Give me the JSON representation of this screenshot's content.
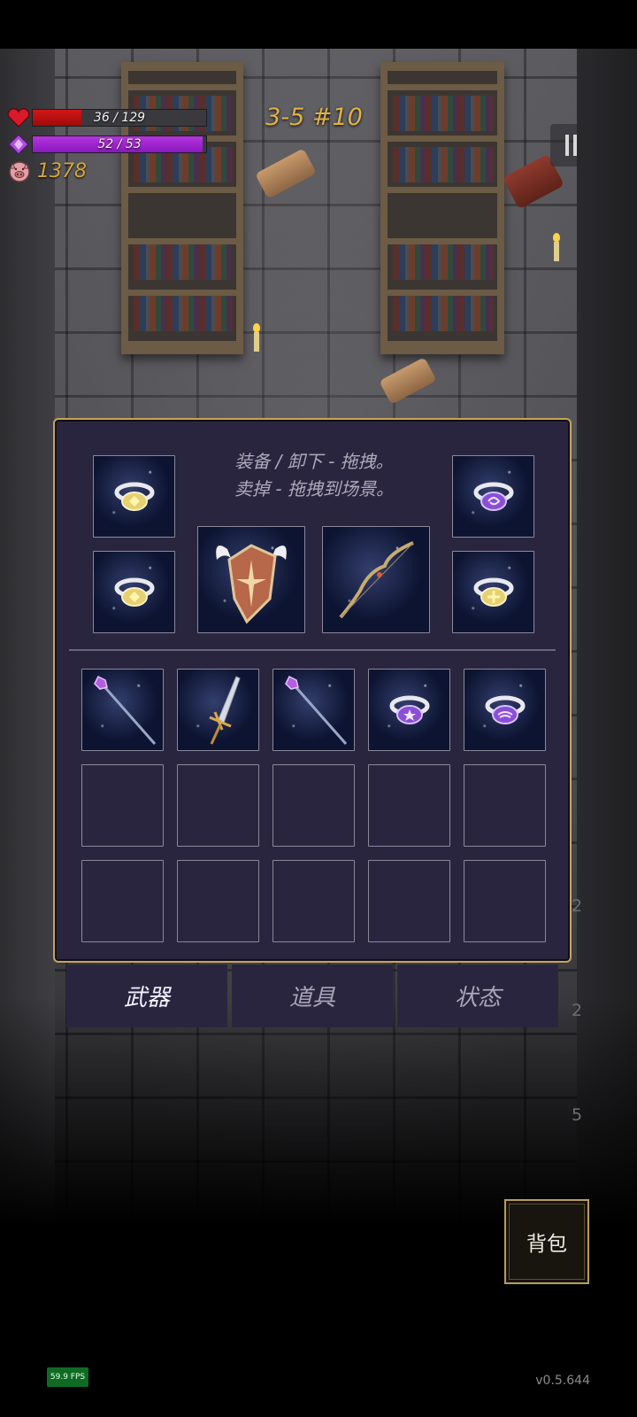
{
  "hud": {
    "hp_text": "36 / 129",
    "hp_fraction": 0.279,
    "mp_text": "52 / 53",
    "mp_fraction": 0.98,
    "gold": "1378",
    "stage": "3-5 #10"
  },
  "inventory": {
    "hint_line1": "装备 / 卸下 - 拖拽。",
    "hint_line2": "卖掉 - 拖拽到场景。",
    "equipped": [
      {
        "slot": "ring-left-top",
        "icon": "gold-ring-icon"
      },
      {
        "slot": "ring-left-bottom",
        "icon": "gold-ring-icon"
      },
      {
        "slot": "offhand",
        "icon": "winged-shield-icon"
      },
      {
        "slot": "weapon",
        "icon": "bow-icon"
      },
      {
        "slot": "ring-right-top",
        "icon": "purple-ring-icon"
      },
      {
        "slot": "ring-right-bottom",
        "icon": "gold-ring-icon"
      }
    ],
    "bag_items": [
      "staff-icon",
      "dagger-icon",
      "staff-icon",
      "purple-ring-icon",
      "purple-ring-icon",
      "",
      "",
      "",
      "",
      "",
      "",
      "",
      "",
      "",
      ""
    ]
  },
  "tabs": [
    {
      "label": "武器",
      "active": true
    },
    {
      "label": "道具",
      "active": false
    },
    {
      "label": "状态",
      "active": false
    }
  ],
  "side_numbers": [
    "2",
    "2",
    "5"
  ],
  "bag_button": "背包",
  "fps": "59.9 FPS",
  "version": "v0.5.644",
  "colors": {
    "panel_bg": "#2a253f",
    "panel_border": "#c7a35b",
    "hp": "#d21616",
    "mp": "#b535e0",
    "gold": "#d4a63d"
  }
}
